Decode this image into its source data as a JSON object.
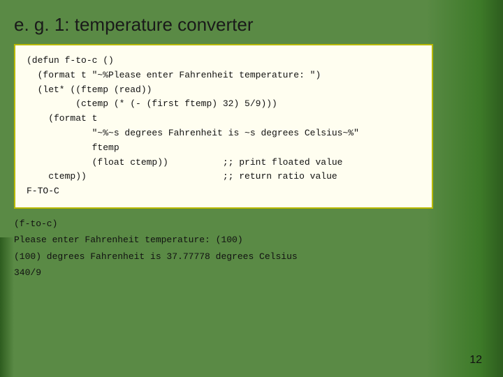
{
  "slide": {
    "title": "e. g. 1:  temperature converter",
    "page_number": "12"
  },
  "code": {
    "lines": [
      "(defun f-to-c ()",
      "  (format t \"~%Please enter Fahrenheit temperature: \")",
      "  (let* ((ftemp (read))",
      "         (ctemp (* (- (first ftemp) 32) 5/9)))",
      "    (format t",
      "            \"~%~s degrees Fahrenheit is ~s degrees Celsius~%\"",
      "            ftemp",
      "            (float ctemp))    ;; print floated value",
      "    ctemp))                   ;; return ratio value",
      "F-TO-C"
    ]
  },
  "output": {
    "lines": [
      "(f-to-c)",
      "Please enter Fahrenheit temperature: (100)",
      "(100) degrees Fahrenheit is 37.77778 degrees Celsius",
      "340/9"
    ]
  }
}
